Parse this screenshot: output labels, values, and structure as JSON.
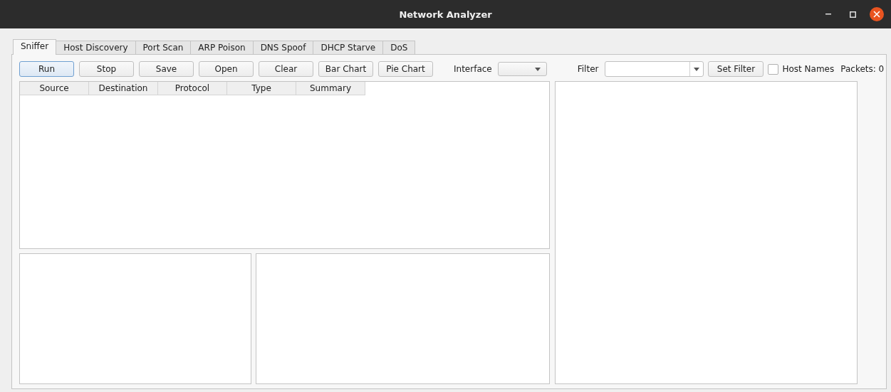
{
  "window": {
    "title": "Network Analyzer"
  },
  "tabs": [
    {
      "label": "Sniffer",
      "selected": true
    },
    {
      "label": "Host Discovery",
      "selected": false
    },
    {
      "label": "Port Scan",
      "selected": false
    },
    {
      "label": "ARP Poison",
      "selected": false
    },
    {
      "label": "DNS Spoof",
      "selected": false
    },
    {
      "label": "DHCP Starve",
      "selected": false
    },
    {
      "label": "DoS",
      "selected": false
    }
  ],
  "buttons": [
    {
      "label": "Run",
      "focused": true
    },
    {
      "label": "Stop",
      "focused": false
    },
    {
      "label": "Save",
      "focused": false
    },
    {
      "label": "Open",
      "focused": false
    },
    {
      "label": "Clear",
      "focused": false
    },
    {
      "label": "Bar Chart",
      "focused": false
    },
    {
      "label": "Pie Chart",
      "focused": false
    }
  ],
  "interface": {
    "label": "Interface"
  },
  "filter": {
    "label": "Filter",
    "button": "Set Filter"
  },
  "host_names": {
    "label": "Host Names",
    "checked": false
  },
  "packets": "Packets: 0",
  "table": {
    "columns": [
      "Source",
      "Destination",
      "Protocol",
      "Type",
      "Summary"
    ]
  }
}
